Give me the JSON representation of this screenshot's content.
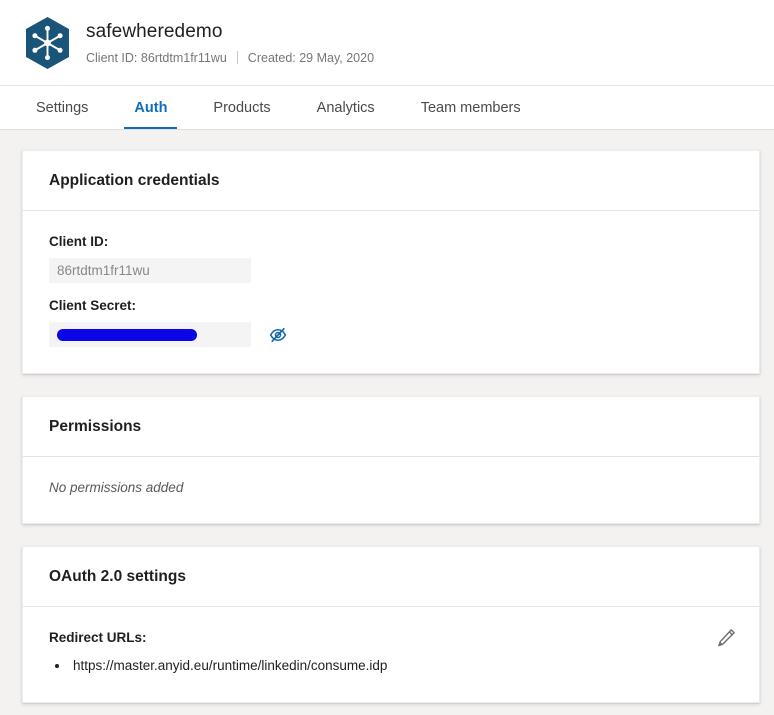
{
  "header": {
    "logo_icon": "snowflake-hexagon-logo",
    "app_name": "safewheredemo",
    "client_id_label": "Client ID: 86rtdtm1fr11wu",
    "created_label": "Created: 29 May, 2020"
  },
  "tabs": [
    {
      "label": "Settings",
      "active": false
    },
    {
      "label": "Auth",
      "active": true
    },
    {
      "label": "Products",
      "active": false
    },
    {
      "label": "Analytics",
      "active": false
    },
    {
      "label": "Team members",
      "active": false
    }
  ],
  "credentials_card": {
    "title": "Application credentials",
    "client_id_label": "Client ID:",
    "client_id_value": "86rtdtm1fr11wu",
    "client_secret_label": "Client Secret:",
    "client_secret_value": "",
    "secret_masked": true,
    "toggle_icon": "eye-slash-icon"
  },
  "permissions_card": {
    "title": "Permissions",
    "empty_text": "No permissions added"
  },
  "oauth_card": {
    "title": "OAuth 2.0 settings",
    "redirect_label": "Redirect URLs:",
    "edit_icon": "pencil-icon",
    "redirect_urls": [
      "https://master.anyid.eu/runtime/linkedin/consume.idp"
    ]
  },
  "colors": {
    "accent": "#0f6cbd",
    "logo": "#1b5479",
    "page_bg": "#f3f2f1",
    "card_bg": "#ffffff",
    "redaction": "#0a06e8",
    "muted_text": "#767676"
  }
}
